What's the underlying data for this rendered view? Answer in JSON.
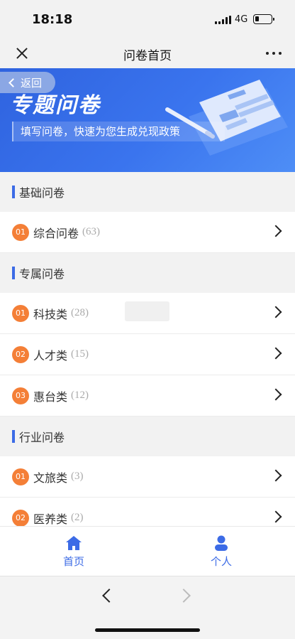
{
  "status_bar": {
    "time": "18:18",
    "network": "4G"
  },
  "nav": {
    "title": "问卷首页"
  },
  "banner": {
    "back_label": "返回",
    "title": "专题问卷",
    "subtitle": "填写问卷，快速为您生成兑现政策"
  },
  "sections": [
    {
      "label": "基础问卷",
      "items": [
        {
          "num": "01",
          "label": "综合问卷",
          "count": "(63)"
        }
      ]
    },
    {
      "label": "专属问卷",
      "items": [
        {
          "num": "01",
          "label": "科技类",
          "count": "(28)"
        },
        {
          "num": "02",
          "label": "人才类",
          "count": "(15)"
        },
        {
          "num": "03",
          "label": "惠台类",
          "count": "(12)"
        }
      ]
    },
    {
      "label": "行业问卷",
      "items": [
        {
          "num": "01",
          "label": "文旅类",
          "count": "(3)"
        },
        {
          "num": "02",
          "label": "医养类",
          "count": "(2)"
        }
      ]
    }
  ],
  "tabs": [
    {
      "label": "首页",
      "icon": "home-icon"
    },
    {
      "label": "个人",
      "icon": "user-icon"
    }
  ],
  "colors": {
    "accent": "#3c6be6",
    "badge": "#f47f37",
    "banner_start": "#2f63df",
    "banner_end": "#4e8ef6"
  }
}
